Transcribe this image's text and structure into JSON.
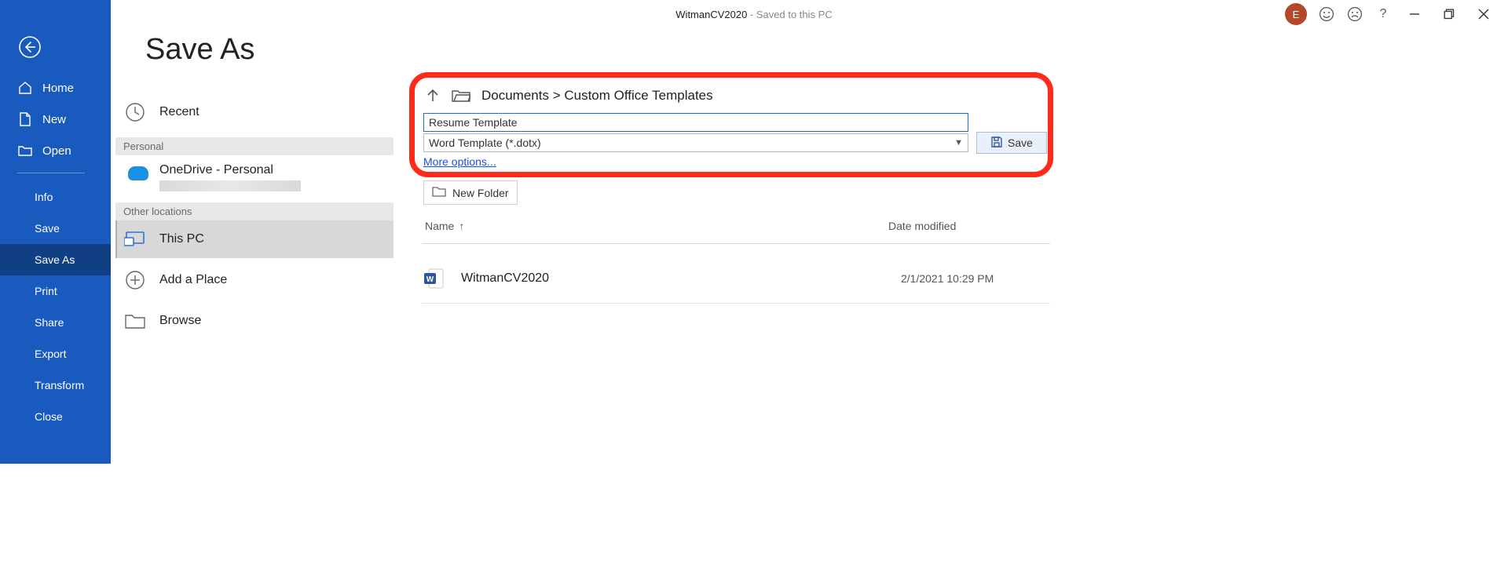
{
  "title": {
    "document": "WitmanCV2020",
    "suffix": " - Saved to this PC"
  },
  "user_initial": "E",
  "sidebar": {
    "home": "Home",
    "new": "New",
    "open": "Open",
    "info": "Info",
    "save": "Save",
    "save_as": "Save As",
    "print": "Print",
    "share": "Share",
    "export": "Export",
    "transform": "Transform",
    "close": "Close"
  },
  "page_heading": "Save As",
  "locations": {
    "recent": "Recent",
    "personal_header": "Personal",
    "onedrive": "OneDrive - Personal",
    "other_header": "Other locations",
    "this_pc": "This PC",
    "add_place": "Add a Place",
    "browse": "Browse"
  },
  "path": {
    "breadcrumb": "Documents > Custom Office Templates"
  },
  "filename_value": "Resume Template",
  "filetype_value": "Word Template (*.dotx)",
  "more_options": "More options...",
  "save_label": "Save",
  "new_folder_label": "New Folder",
  "list_headers": {
    "name": "Name",
    "date": "Date modified"
  },
  "files": {
    "0": {
      "name": "WitmanCV2020",
      "date": "2/1/2021 10:29 PM"
    }
  }
}
